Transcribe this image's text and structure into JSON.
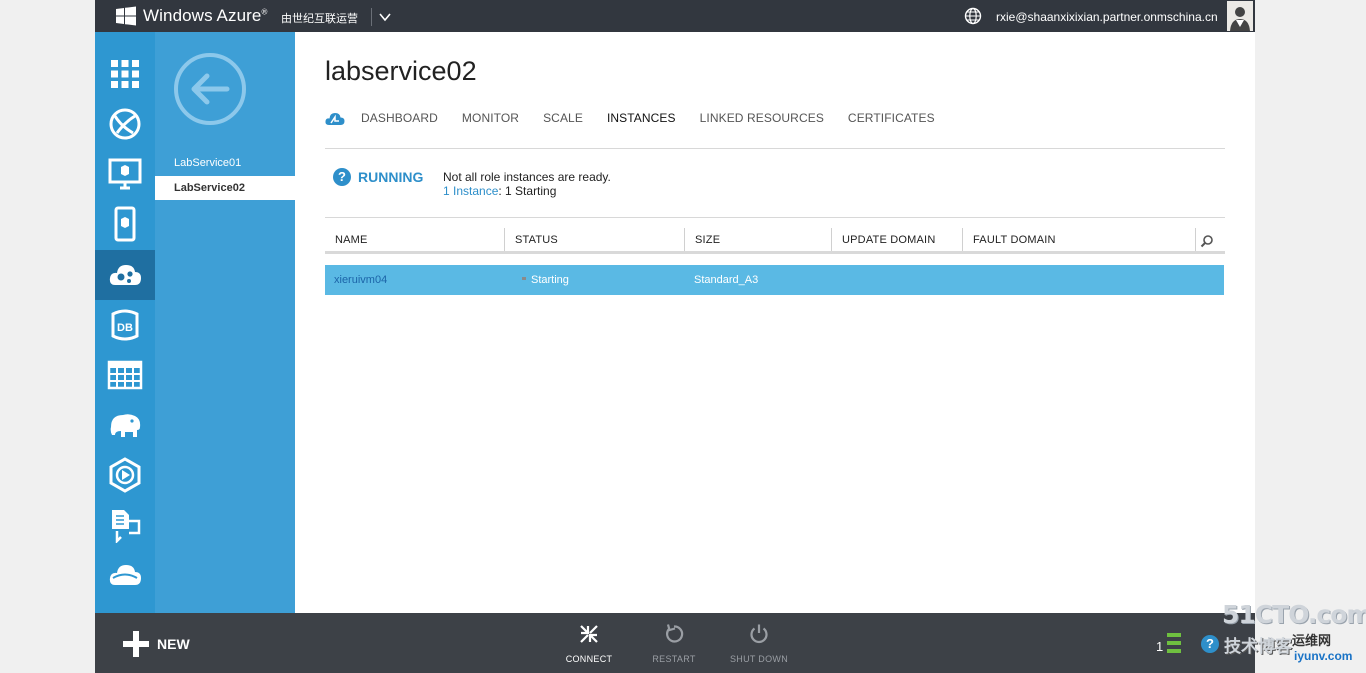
{
  "topbar": {
    "brand": "Windows Azure",
    "brand_mark": "®",
    "operator": "由世纪互联运营",
    "user_email": "rxie@shaanxixixian.partner.onmschina.cn"
  },
  "subnav": {
    "items": [
      {
        "label": "LabService01",
        "selected": false
      },
      {
        "label": "LabService02",
        "selected": true
      }
    ]
  },
  "main": {
    "title": "labservice02",
    "tabs": [
      "DASHBOARD",
      "MONITOR",
      "SCALE",
      "INSTANCES",
      "LINKED RESOURCES",
      "CERTIFICATES"
    ],
    "active_tab": "INSTANCES",
    "status": {
      "icon": "?",
      "state": "RUNNING",
      "message": "Not all role instances are ready.",
      "detail_link": "1 Instance",
      "detail_rest": ": 1 Starting"
    },
    "grid": {
      "columns": [
        "NAME",
        "STATUS",
        "SIZE",
        "UPDATE DOMAIN",
        "FAULT DOMAIN"
      ],
      "rows": [
        {
          "name": "xieruivm04",
          "status": "Starting",
          "size": "Standard_A3",
          "update_domain": "",
          "fault_domain": ""
        }
      ]
    }
  },
  "bottombar": {
    "new_label": "NEW",
    "commands": [
      {
        "label": "CONNECT",
        "enabled": true
      },
      {
        "label": "RESTART",
        "enabled": false
      },
      {
        "label": "SHUT DOWN",
        "enabled": false
      }
    ],
    "notification_count": "1",
    "help_icon": "?"
  },
  "watermark": {
    "top": "51CTO.com",
    "left": "技术博客",
    "right": "运维网",
    "url": "iyunv.com"
  },
  "colors": {
    "topbar": "#32373f",
    "nav": "#2e97d1",
    "nav_active": "#1f6fa1",
    "accent": "#2e8fca",
    "row_selected": "#5ab9e4",
    "bottombar": "#3d4147"
  }
}
